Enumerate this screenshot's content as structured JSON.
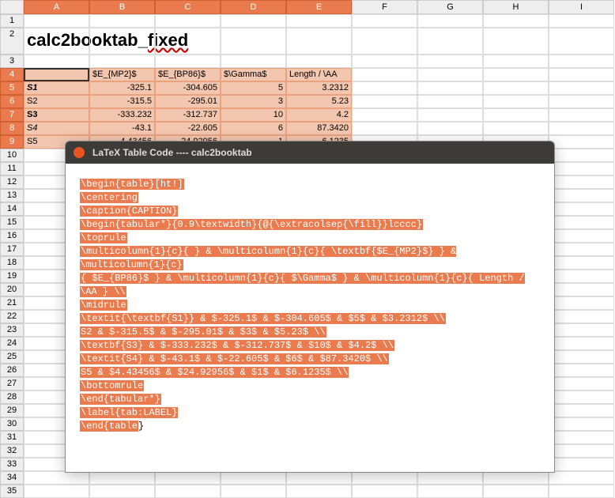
{
  "columns": [
    "A",
    "B",
    "C",
    "D",
    "E",
    "F",
    "G",
    "H",
    "I"
  ],
  "selected_cols": [
    "A",
    "B",
    "C",
    "D",
    "E"
  ],
  "title_cell": "calc2booktab_fixed",
  "table": {
    "headers": [
      "",
      "$E_{MP2}$",
      "$E_{BP86}$",
      "$\\Gamma$",
      "Length / \\AA"
    ],
    "rows": [
      {
        "label": "S1",
        "bold": true,
        "ital": true,
        "vals": [
          "-325.1",
          "-304.605",
          "5",
          "3.2312"
        ]
      },
      {
        "label": "S2",
        "bold": false,
        "ital": false,
        "vals": [
          "-315.5",
          "-295.01",
          "3",
          "5.23"
        ]
      },
      {
        "label": "S3",
        "bold": true,
        "ital": false,
        "vals": [
          "-333.232",
          "-312.737",
          "10",
          "4.2"
        ]
      },
      {
        "label": "S4",
        "bold": false,
        "ital": true,
        "vals": [
          "-43.1",
          "-22.605",
          "6",
          "87.3420"
        ]
      },
      {
        "label": "S5",
        "bold": false,
        "ital": false,
        "vals": [
          "4.43456",
          "24.92956",
          "1",
          "6.1235"
        ]
      }
    ]
  },
  "row_numbers_plain": [
    1,
    3,
    10,
    11,
    12,
    13,
    14,
    15,
    16,
    17,
    18,
    19,
    20,
    21,
    22,
    23,
    24,
    25,
    26,
    27,
    28,
    29,
    30,
    31,
    32,
    33,
    34,
    35
  ],
  "dialog": {
    "title": "LaTeX Table Code ---- calc2booktab",
    "lines": [
      "\\begin{table}[ht!]",
      "\\centering",
      "\\caption{CAPTION}",
      "\\begin{tabular*}{0.9\\textwidth}{@{\\extracolsep{\\fill}}lcccc}",
      "\\toprule",
      "\\multicolumn{1}{c}{ } & \\multicolumn{1}{c}{ \\textbf{$E_{MP2}$} } & \\multicolumn{1}{c}",
      "{ $E_{BP86}$ } & \\multicolumn{1}{c}{ $\\Gamma$ } & \\multicolumn{1}{c}{ Length / \\AA } \\\\",
      "\\midrule",
      "\\textit{\\textbf{S1}} & $-325.1$ & $-304.605$ & $5$ & $3.2312$ \\\\",
      "S2 & $-315.5$ & $-295.01$ & $3$ & $5.23$ \\\\",
      "\\textbf{S3} & $-333.232$ & $-312.737$ & $10$ & $4.2$ \\\\",
      "\\textit{S4} & $-43.1$ & $-22.605$ & $6$ & $87.3420$ \\\\",
      "S5 & $4.43456$ & $24.92956$ & $1$ & $6.1235$ \\\\",
      "\\bottomrule",
      "\\end{tabular*}",
      "\\label{tab:LABEL}",
      "\\end{table}"
    ],
    "last_line_unhighlighted_tail": "}"
  }
}
